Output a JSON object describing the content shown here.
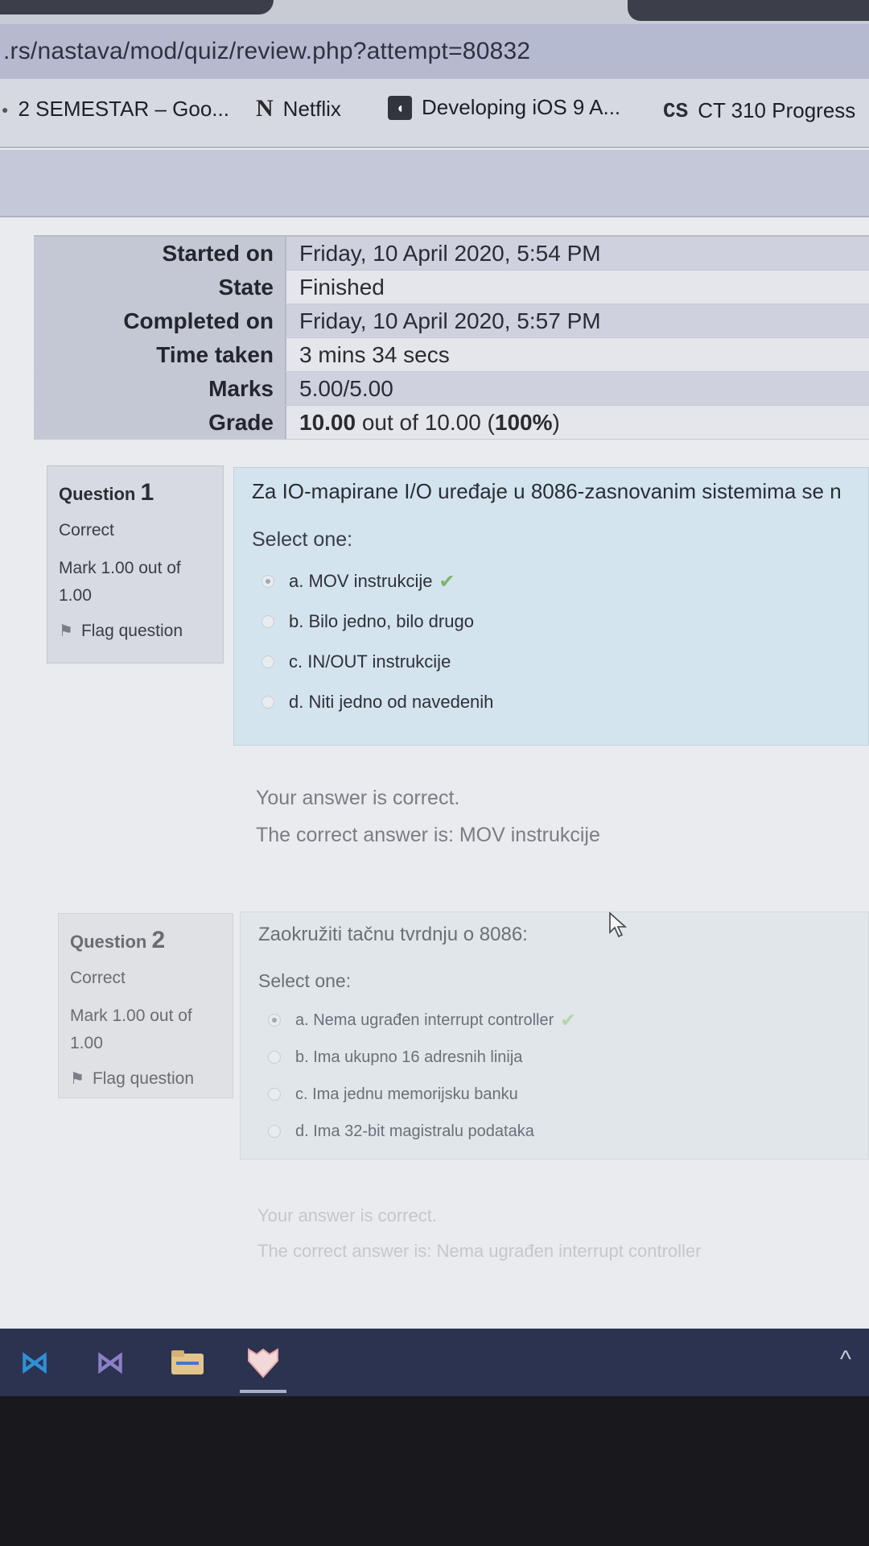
{
  "browser": {
    "url": ".rs/nastava/mod/quiz/review.php?attempt=80832",
    "bookmarks": [
      {
        "label": "2 SEMESTAR – Goo...",
        "icon": "dot-icon"
      },
      {
        "label": "Netflix",
        "icon": "netflix-icon"
      },
      {
        "label": "Developing iOS 9 A...",
        "icon": "itunes-icon"
      },
      {
        "label": "CT 310 Progress",
        "icon": "cs-icon"
      }
    ]
  },
  "summary": {
    "rows": [
      {
        "key": "Started on",
        "value": "Friday, 10 April 2020, 5:54 PM"
      },
      {
        "key": "State",
        "value": "Finished"
      },
      {
        "key": "Completed on",
        "value": "Friday, 10 April 2020, 5:57 PM"
      },
      {
        "key": "Time taken",
        "value": "3 mins 34 secs"
      },
      {
        "key": "Marks",
        "value": "5.00/5.00"
      }
    ],
    "grade": {
      "key": "Grade",
      "value_bold": "10.00",
      "value_mid": " out of 10.00 (",
      "value_pct": "100%",
      "value_end": ")"
    }
  },
  "questions": [
    {
      "label": "Question",
      "number": "1",
      "state": "Correct",
      "mark": "Mark 1.00 out of 1.00",
      "flag_label": "Flag question",
      "text": "Za IO-mapirane I/O uređaje u 8086-zasnovanim sistemima se n",
      "prompt": "Select one:",
      "answers": [
        {
          "label": "a. MOV instrukcije",
          "checked": true,
          "correct_mark": true
        },
        {
          "label": "b. Bilo jedno, bilo drugo",
          "checked": false,
          "correct_mark": false
        },
        {
          "label": "c. IN/OUT instrukcije",
          "checked": false,
          "correct_mark": false
        },
        {
          "label": "d. Niti jedno od navedenih",
          "checked": false,
          "correct_mark": false
        }
      ],
      "feedback_correct": "Your answer is correct.",
      "feedback_answer": "The correct answer is: MOV instrukcije"
    },
    {
      "label": "Question",
      "number": "2",
      "state": "Correct",
      "mark": "Mark 1.00 out of 1.00",
      "flag_label": "Flag question",
      "text": "Zaokružiti tačnu tvrdnju o 8086:",
      "prompt": "Select one:",
      "answers": [
        {
          "label": "a. Nema ugrađen interrupt controller",
          "checked": true,
          "correct_mark": true
        },
        {
          "label": "b. Ima ukupno 16 adresnih linija",
          "checked": false,
          "correct_mark": false
        },
        {
          "label": "c. Ima jednu memorijsku banku",
          "checked": false,
          "correct_mark": false
        },
        {
          "label": "d. Ima 32-bit magistralu podataka",
          "checked": false,
          "correct_mark": false
        }
      ],
      "feedback_correct": "Your answer is correct.",
      "feedback_answer": "The correct answer is: Nema ugrađen interrupt controller"
    }
  ],
  "taskbar": {
    "icons": [
      "vscode-icon",
      "visual-studio-icon",
      "file-explorer-icon",
      "heart-app-icon"
    ],
    "tray_arrow": "^"
  },
  "colors": {
    "question_bg": "#d4e4ee",
    "info_bg": "#d7dae0",
    "correct_check": "#7fb36a",
    "taskbar": "#2b3350"
  }
}
